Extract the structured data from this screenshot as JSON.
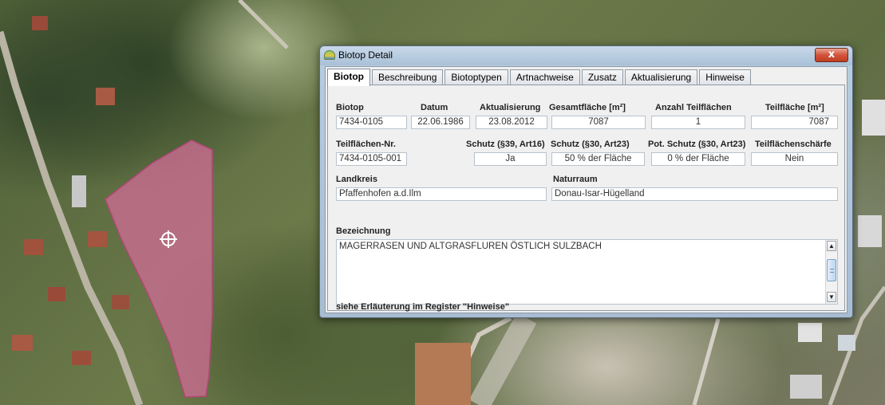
{
  "window": {
    "title": "Biotop Detail",
    "close_label": "x"
  },
  "tabs": [
    {
      "label": "Biotop",
      "active": true
    },
    {
      "label": "Beschreibung",
      "active": false
    },
    {
      "label": "Biotoptypen",
      "active": false
    },
    {
      "label": "Artnachweise",
      "active": false
    },
    {
      "label": "Zusatz",
      "active": false
    },
    {
      "label": "Aktualisierung",
      "active": false
    },
    {
      "label": "Hinweise",
      "active": false
    }
  ],
  "biotop": {
    "biotop_label": "Biotop",
    "biotop_value": "7434-0105",
    "datum_label": "Datum",
    "datum_value": "22.06.1986",
    "aktualisierung_label": "Aktualisierung",
    "aktualisierung_value": "23.08.2012",
    "gesamtflaeche_label": "Gesamtfläche [m²]",
    "gesamtflaeche_value": "7087",
    "anzahl_label": "Anzahl Teilflächen",
    "anzahl_value": "1",
    "teilflaeche_label": "Teilfläche [m²]",
    "teilflaeche_value": "7087",
    "teilflaechen_nr_label": "Teilflächen-Nr.",
    "teilflaechen_nr_value": "7434-0105-001",
    "schutz39_label": "Schutz (§39, Art16)",
    "schutz39_value": "Ja",
    "schutz30_label": "Schutz (§30, Art23)",
    "schutz30_value": "50 % der Fläche",
    "pot_schutz_label": "Pot. Schutz (§30, Art23)",
    "pot_schutz_value": "0 % der Fläche",
    "schaerfe_label": "Teilflächenschärfe",
    "schaerfe_value": "Nein",
    "landkreis_label": "Landkreis",
    "landkreis_value": "Pfaffenhofen a.d.Ilm",
    "naturraum_label": "Naturraum",
    "naturraum_value": "Donau-Isar-Hügelland",
    "bezeichnung_label": "Bezeichnung",
    "bezeichnung_value": "MAGERRASEN UND ALTGRASFLUREN ÖSTLICH SULZBACH",
    "hint": "siehe Erläuterung im Register \"Hinweise\""
  },
  "scrollbar": {
    "up_arrow": "▲",
    "down_arrow": "▼"
  },
  "map": {
    "polygon_color": "#d06c95"
  }
}
